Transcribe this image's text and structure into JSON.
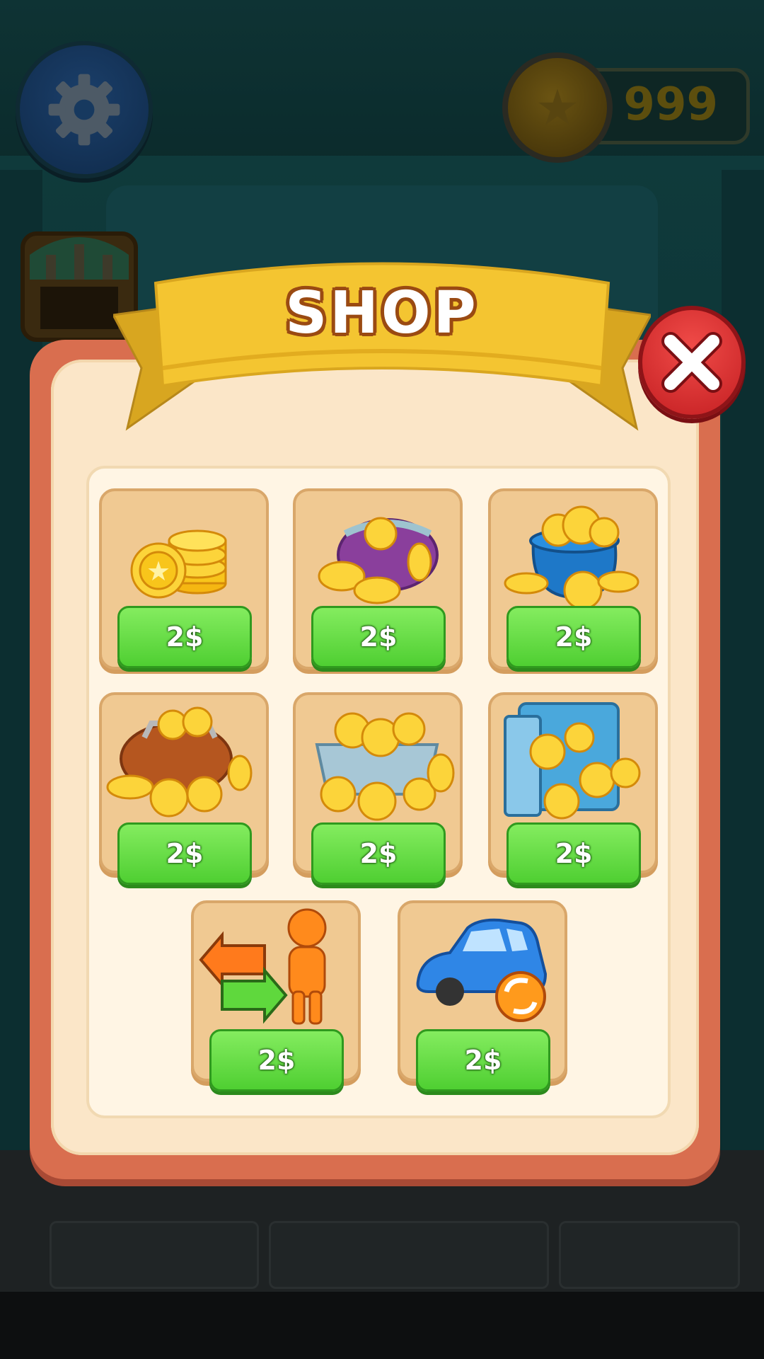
{
  "hud": {
    "coin_count": "999",
    "settings_icon": "gear-icon",
    "coin_icon": "star-coin-icon"
  },
  "shop": {
    "title": "SHOP",
    "close_icon": "close-icon",
    "items": [
      {
        "icon": "coin-stack-icon",
        "price": "2$"
      },
      {
        "icon": "coin-purse-icon",
        "price": "2$"
      },
      {
        "icon": "coin-pot-icon",
        "price": "2$"
      },
      {
        "icon": "coin-bag-icon",
        "price": "2$"
      },
      {
        "icon": "coin-crate-icon",
        "price": "2$"
      },
      {
        "icon": "coin-vault-icon",
        "price": "2$"
      },
      {
        "icon": "swap-character-icon",
        "price": "2$"
      },
      {
        "icon": "swap-car-icon",
        "price": "2$"
      }
    ]
  },
  "colors": {
    "panel_border": "#d96e4f",
    "panel_fill": "#fbe6c8",
    "banner": "#f4c531",
    "buy_button": "#5fd83d",
    "close_button": "#e0302f"
  }
}
